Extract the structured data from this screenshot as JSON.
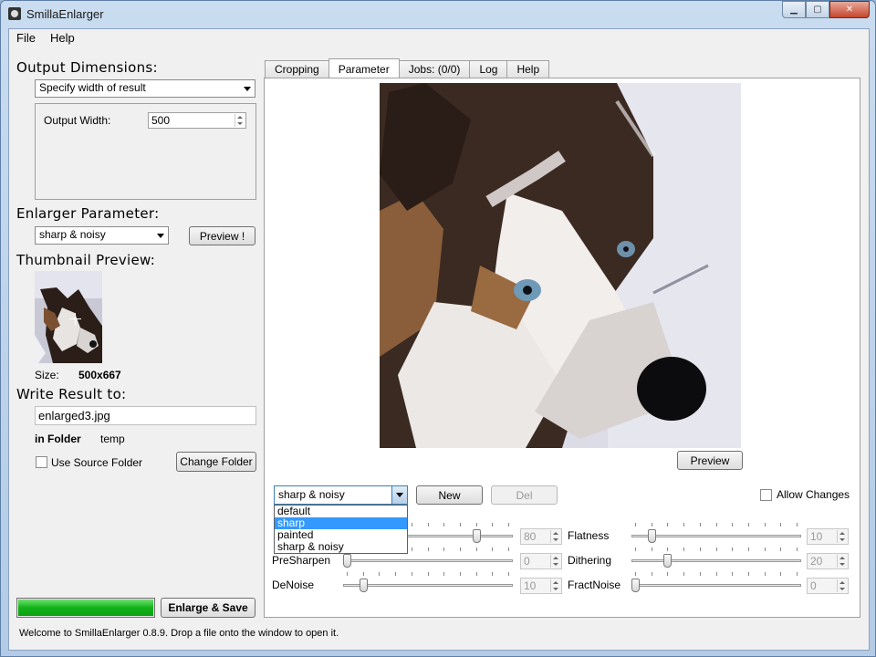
{
  "window": {
    "title": "SmillaEnlarger"
  },
  "menu": [
    "File",
    "Help"
  ],
  "left": {
    "output_dimensions_heading": "Output Dimensions:",
    "dimension_mode": "Specify width of result",
    "output_width_label": "Output Width:",
    "output_width_value": "500",
    "enlarger_parameter_heading": "Enlarger Parameter:",
    "enlarger_preset": "sharp & noisy",
    "preview_button": "Preview !",
    "thumbnail_heading": "Thumbnail Preview:",
    "size_label": "Size:",
    "size_value": "500x667",
    "write_result_heading": "Write Result to:",
    "output_filename": "enlarged3.jpg",
    "in_folder_label": "in Folder",
    "folder_value": "temp",
    "use_source_folder_label": "Use Source Folder",
    "use_source_folder_checked": false,
    "change_folder_button": "Change Folder",
    "enlarge_save_button": "Enlarge & Save",
    "progress": 1.0
  },
  "tabs": [
    {
      "label": "Cropping",
      "active": false
    },
    {
      "label": "Parameter",
      "active": true
    },
    {
      "label": "Jobs: (0/0)",
      "active": false
    },
    {
      "label": "Log",
      "active": false
    },
    {
      "label": "Help",
      "active": false
    }
  ],
  "parameter": {
    "preview_button": "Preview",
    "preset_value": "sharp & noisy",
    "preset_options": [
      "default",
      "sharp",
      "painted",
      "sharp & noisy"
    ],
    "preset_highlighted": "sharp",
    "new_button": "New",
    "del_button": "Del",
    "allow_changes_label": "Allow Changes",
    "allow_changes_checked": false,
    "sliders": [
      {
        "label": "",
        "value": "80",
        "level": 0.8,
        "column": "left"
      },
      {
        "label": "PreSharpen",
        "value": "0",
        "level": 0.0,
        "column": "left"
      },
      {
        "label": "DeNoise",
        "value": "10",
        "level": 0.1,
        "column": "left"
      },
      {
        "label": "Flatness",
        "value": "10",
        "level": 0.1,
        "column": "right"
      },
      {
        "label": "Dithering",
        "value": "20",
        "level": 0.2,
        "column": "right"
      },
      {
        "label": "FractNoise",
        "value": "0",
        "level": 0.0,
        "column": "right"
      }
    ]
  },
  "status": "Welcome to SmillaEnlarger 0.8.9.  Drop a file onto the window to open it.",
  "colors": {
    "progress_fill": "#12b21a",
    "selection": "#3399ff"
  },
  "icons": [
    "app-icon",
    "minimize-icon",
    "maximize-icon",
    "close-icon",
    "chevron-down-icon",
    "crosshair-icon"
  ]
}
